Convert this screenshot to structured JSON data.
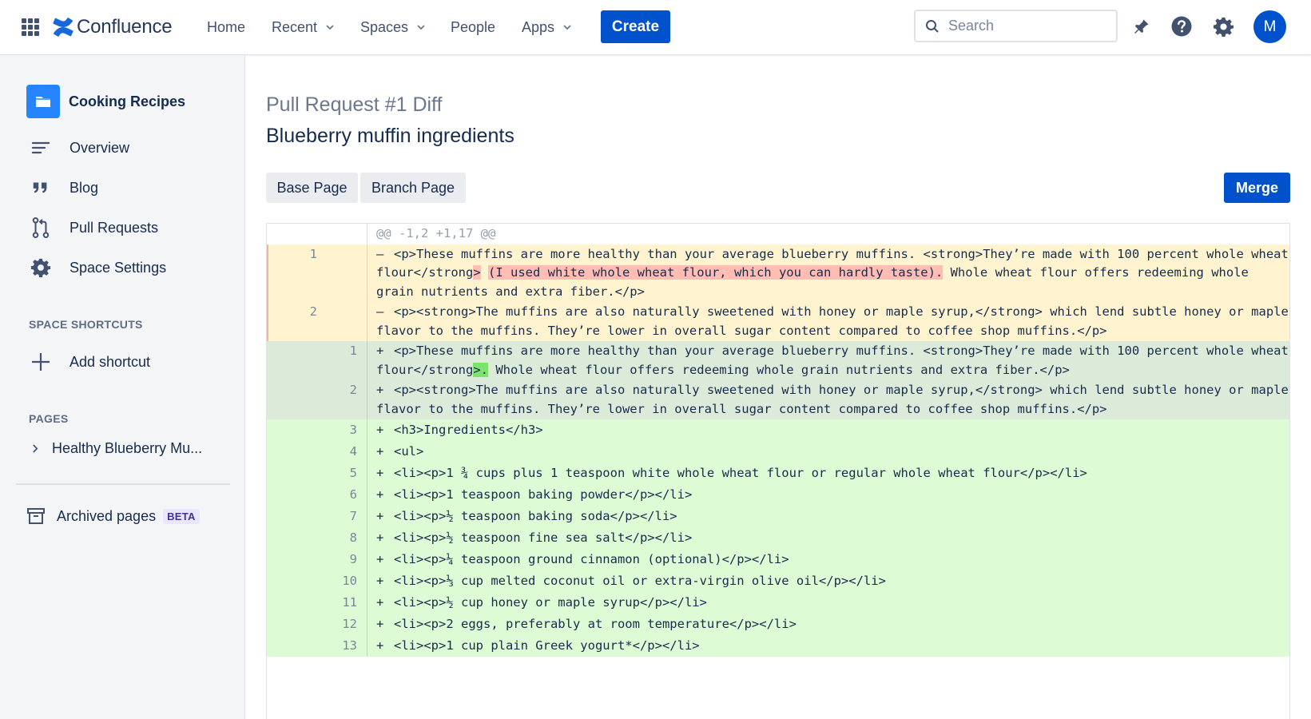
{
  "nav": {
    "brand": "Confluence",
    "home": "Home",
    "recent": "Recent",
    "spaces": "Spaces",
    "people": "People",
    "apps": "Apps",
    "create": "Create",
    "search_placeholder": "Search",
    "avatar_initial": "M"
  },
  "sidebar": {
    "space_name": "Cooking Recipes",
    "items": [
      "Overview",
      "Blog",
      "Pull Requests",
      "Space Settings"
    ],
    "shortcuts_label": "SPACE SHORTCUTS",
    "add_shortcut": "Add shortcut",
    "pages_label": "PAGES",
    "page_item": "Healthy Blueberry Mu...",
    "archived": "Archived pages",
    "beta": "BETA"
  },
  "main": {
    "pr_title": "Pull Request #1 Diff",
    "page_title": "Blueberry muffin ingredients",
    "tabs": [
      "Base Page",
      "Branch Page"
    ],
    "merge": "Merge"
  },
  "diff": {
    "hunk": "@@ -1,2 +1,17 @@",
    "deleted": [
      {
        "line": "1",
        "before": "<p>These muffins are more healthy than your average blueberry muffins. <strong>They’re made with 100 percent whole wheat flour</strong",
        "hl1": ">",
        "mid": " ",
        "hl2": "(I used white whole wheat flour, which you can hardly taste).",
        "after": " Whole wheat flour offers redeeming whole grain nutrients and extra fiber.</p>"
      },
      {
        "line": "2",
        "text": "<p><strong>The muffins are also naturally sweetened with honey or maple syrup,</strong> which lend subtle honey or maple flavor to the muffins. They’re lower in overall sugar content compared to coffee shop muffins.</p>"
      }
    ],
    "modified": [
      {
        "line": "1",
        "before": "<p>These muffins are more healthy than your average blueberry muffins. <strong>They’re made with 100 percent whole wheat flour</strong",
        "hl": ">.",
        "after": " Whole wheat flour offers redeeming whole grain nutrients and extra fiber.</p>"
      },
      {
        "line": "2",
        "text": "<p><strong>The muffins are also naturally sweetened with honey or maple syrup,</strong> which lend subtle honey or maple flavor to the muffins. They’re lower in overall sugar content compared to coffee shop muffins.</p>"
      }
    ],
    "added": [
      {
        "line": "3",
        "text": "<h3>Ingredients</h3>"
      },
      {
        "line": "4",
        "text": "<ul>"
      },
      {
        "line": "5",
        "text": "<li><p>1 ¾ cups plus 1 teaspoon white whole wheat flour or regular whole wheat flour</p></li>"
      },
      {
        "line": "6",
        "text": "<li><p>1 teaspoon baking powder</p></li>"
      },
      {
        "line": "7",
        "text": "<li><p>½ teaspoon baking soda</p></li>"
      },
      {
        "line": "8",
        "text": "<li><p>½ teaspoon fine sea salt</p></li>"
      },
      {
        "line": "9",
        "text": "<li><p>¼ teaspoon ground cinnamon (optional)</p></li>"
      },
      {
        "line": "10",
        "text": "<li><p>⅓ cup melted coconut oil or extra-virgin olive oil</p></li>"
      },
      {
        "line": "11",
        "text": "<li><p>½ cup honey or maple syrup</p></li>"
      },
      {
        "line": "12",
        "text": "<li><p>2 eggs, preferably at room temperature</p></li>"
      },
      {
        "line": "13",
        "text": "<li><p>1 cup plain Greek yogurt*</p></li>"
      }
    ],
    "minus": "–",
    "plus": "+"
  },
  "colors": {
    "primary": "#0052cc",
    "deleted_bg": "#fff4cf",
    "modified_bg": "#dcebd9",
    "added_bg": "#ddfcd6",
    "deleted_highlight": "#ffbdb3",
    "added_highlight": "#7ee36c"
  },
  "icons": [
    "app-grid-icon",
    "confluence-logo-icon",
    "search-icon",
    "notification-icon",
    "help-icon",
    "settings-icon",
    "overview-icon",
    "blog-quote-icon",
    "pull-request-icon",
    "space-settings-icon",
    "plus-icon",
    "chevron-right-icon",
    "archive-icon"
  ]
}
